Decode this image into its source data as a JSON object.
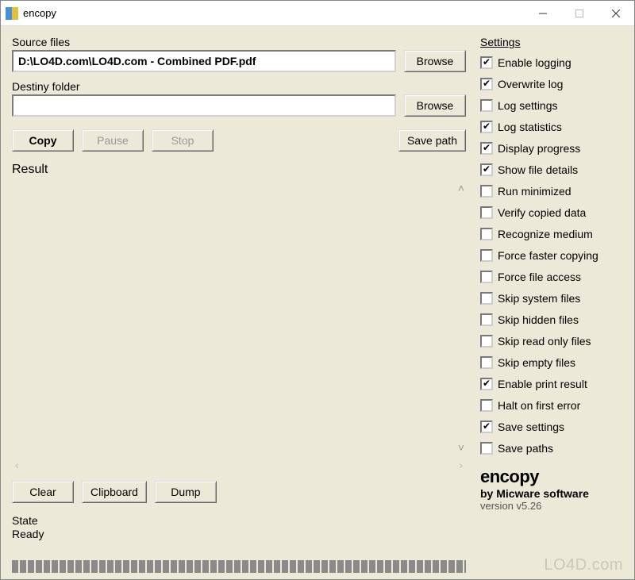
{
  "window": {
    "title": "encopy"
  },
  "labels": {
    "source_files": "Source files",
    "destiny_folder": "Destiny folder",
    "result": "Result",
    "state": "State",
    "settings": "Settings"
  },
  "inputs": {
    "source_value": "D:\\LO4D.com\\LO4D.com - Combined PDF.pdf",
    "destiny_value": ""
  },
  "buttons": {
    "browse_source": "Browse",
    "browse_destiny": "Browse",
    "copy": "Copy",
    "pause": "Pause",
    "stop": "Stop",
    "save_path": "Save path",
    "clear": "Clear",
    "clipboard": "Clipboard",
    "dump": "Dump"
  },
  "status": {
    "state_value": "Ready"
  },
  "settings": [
    {
      "label": "Enable logging",
      "checked": true
    },
    {
      "label": "Overwrite log",
      "checked": true
    },
    {
      "label": "Log settings",
      "checked": false
    },
    {
      "label": "Log statistics",
      "checked": true
    },
    {
      "label": "Display progress",
      "checked": true
    },
    {
      "label": "Show file details",
      "checked": true
    },
    {
      "label": "Run minimized",
      "checked": false
    },
    {
      "label": "Verify copied data",
      "checked": false
    },
    {
      "label": "Recognize medium",
      "checked": false
    },
    {
      "label": "Force faster copying",
      "checked": false
    },
    {
      "label": "Force file access",
      "checked": false
    },
    {
      "label": "Skip system files",
      "checked": false
    },
    {
      "label": "Skip hidden files",
      "checked": false
    },
    {
      "label": "Skip read only files",
      "checked": false
    },
    {
      "label": "Skip empty files",
      "checked": false
    },
    {
      "label": "Enable print result",
      "checked": true
    },
    {
      "label": "Halt on first error",
      "checked": false
    },
    {
      "label": "Save settings",
      "checked": true
    },
    {
      "label": "Save paths",
      "checked": false
    }
  ],
  "brand": {
    "name": "encopy",
    "company": "by Micware software",
    "version": "version v5.26"
  },
  "watermark": "LO4D.com"
}
